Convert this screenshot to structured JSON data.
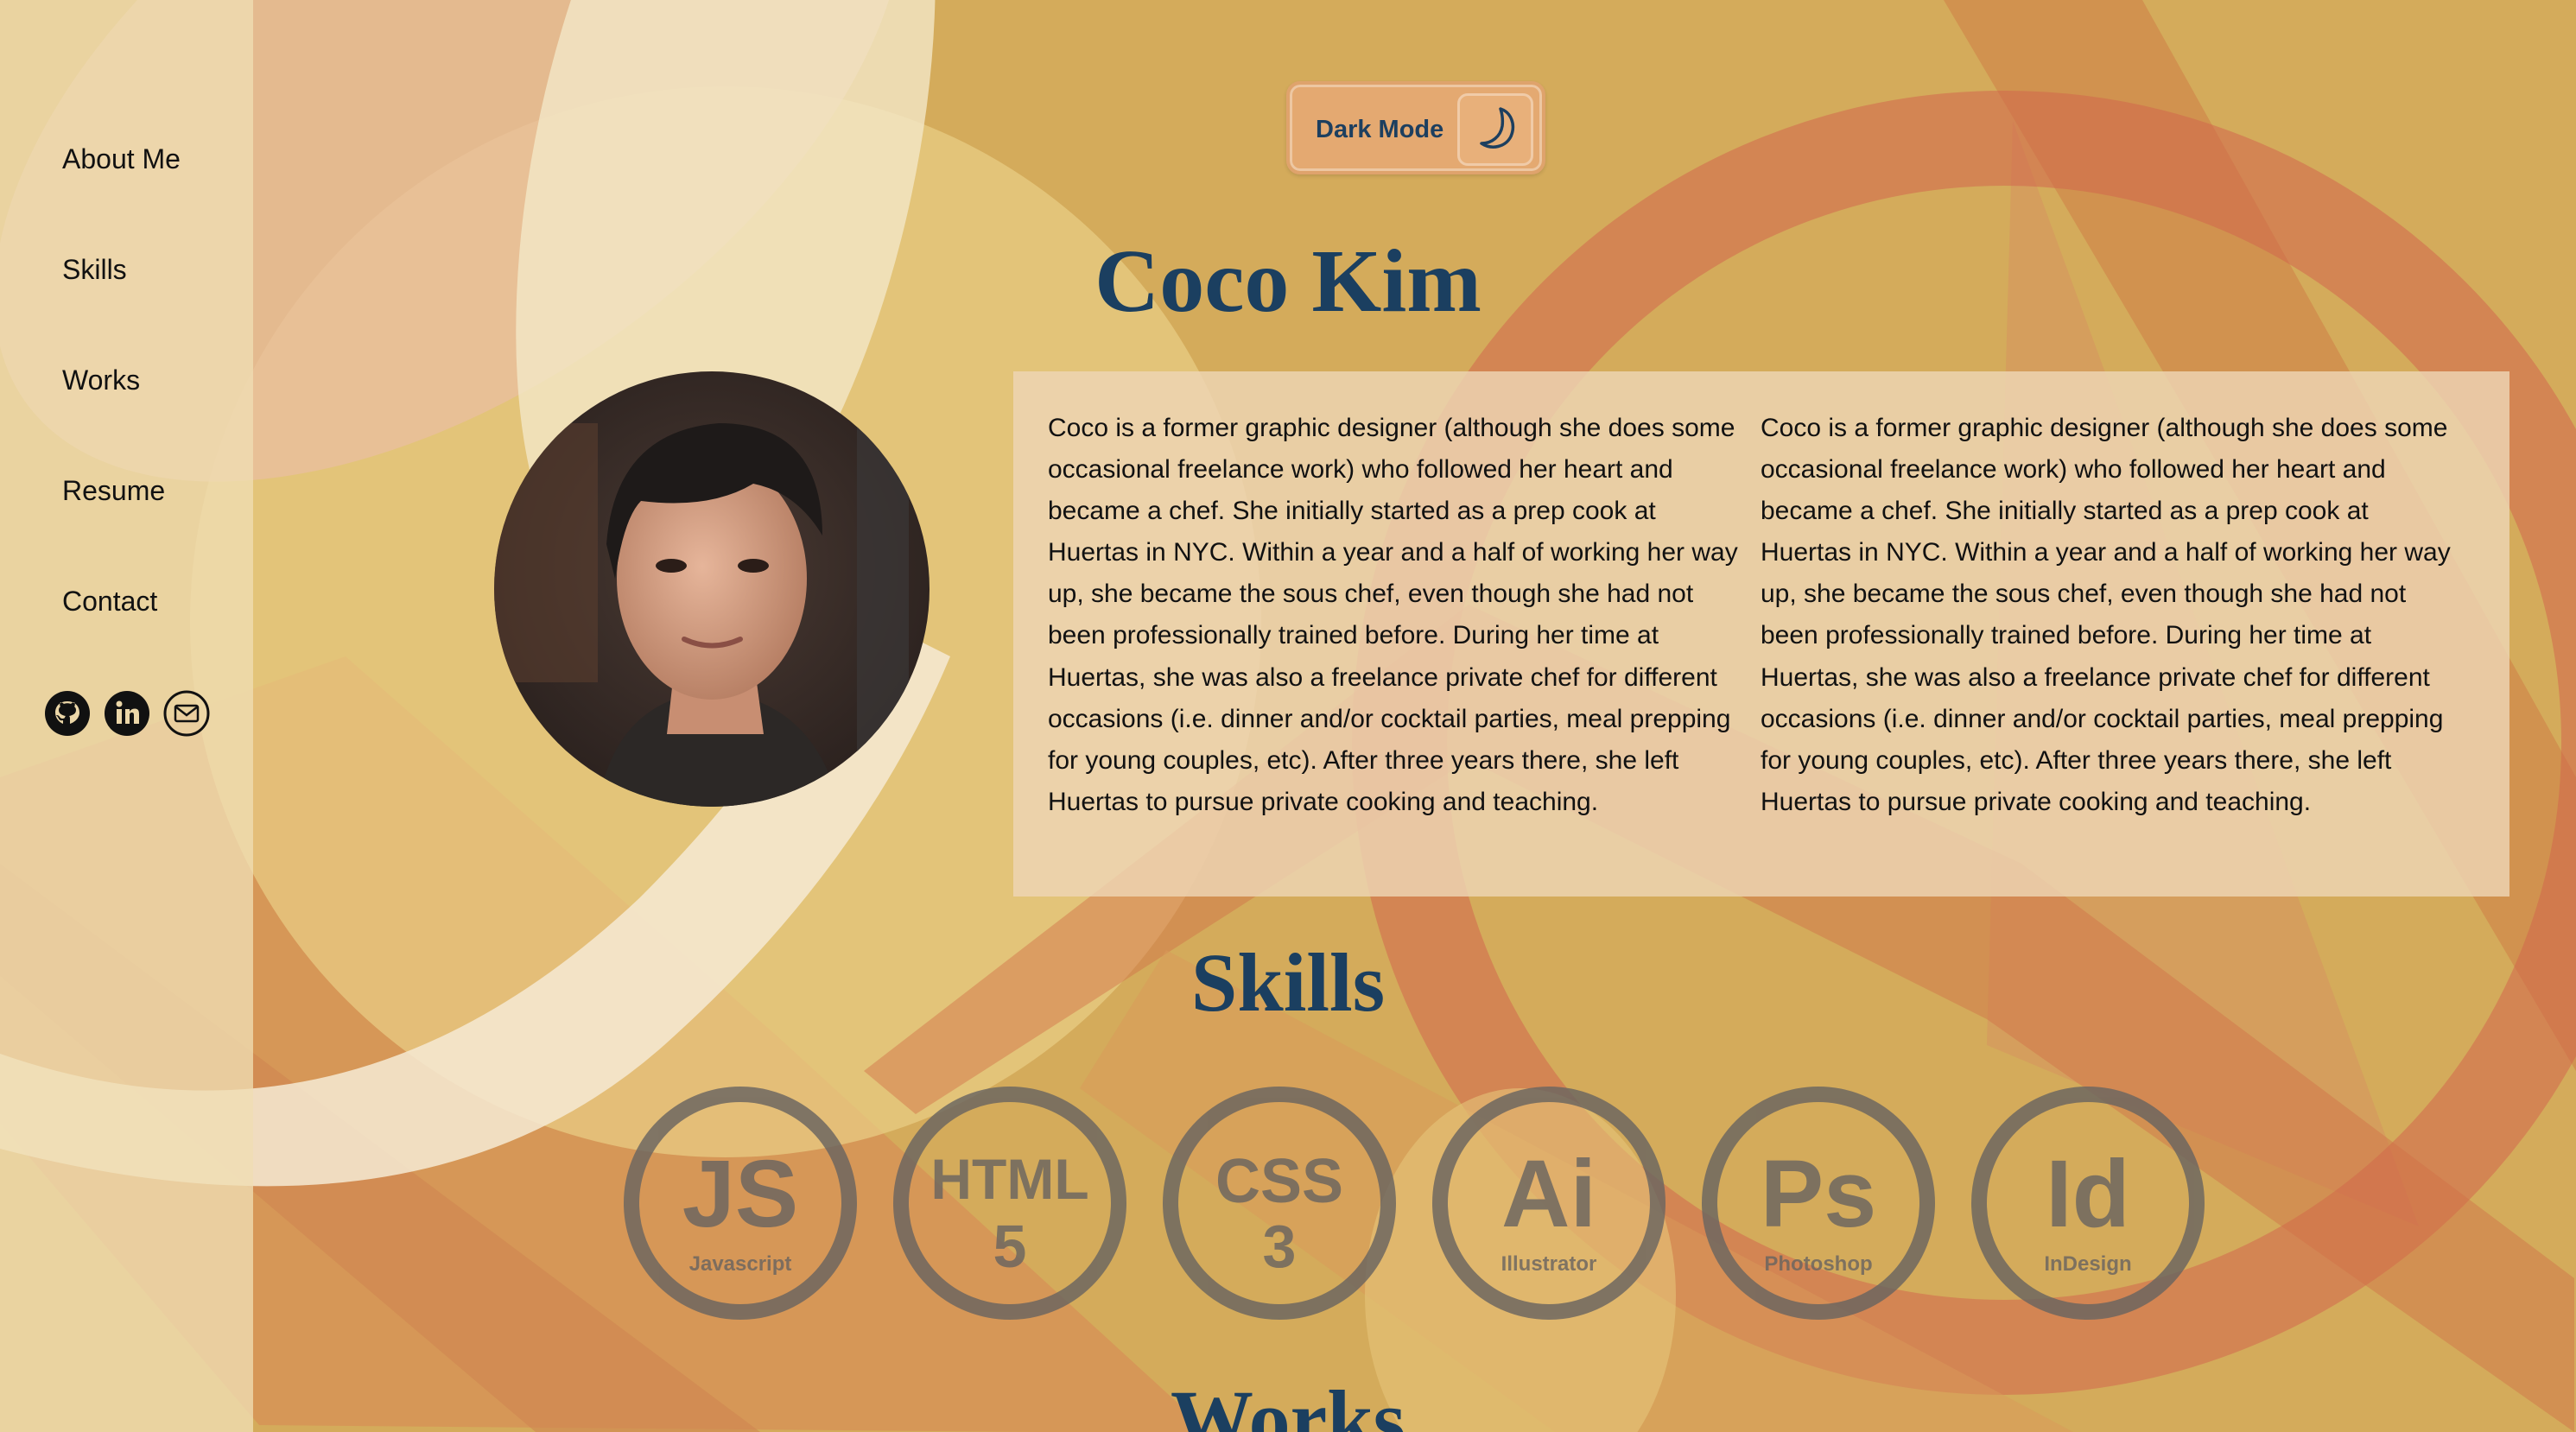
{
  "sidebar": {
    "items": [
      {
        "label": "About Me"
      },
      {
        "label": "Skills"
      },
      {
        "label": "Works"
      },
      {
        "label": "Resume"
      },
      {
        "label": "Contact"
      }
    ],
    "social_icons": [
      "github-icon",
      "linkedin-icon",
      "email-icon"
    ]
  },
  "toggle": {
    "label": "Dark Mode",
    "icon": "moon-icon"
  },
  "hero": {
    "name": "Coco Kim",
    "bio": "Coco is a former graphic designer (although she does some occasional freelance work) who followed her heart and became a chef. She initially started as a prep cook at Huertas in NYC. Within a year and a half of working her way up, she became the sous chef, even though she had not been professionally trained before. During her time at Huertas, she was also a freelance private chef for different occasions (i.e. dinner and/or cocktail parties, meal prepping for young couples, etc). After three years there, she left Huertas to pursue private cooking and teaching.",
    "bio_repeat": "Coco is a former graphic designer (although she does some occasional freelance work) who followed her heart and became a chef. She initially started as a prep cook at Huertas in NYC. Within a year and a half of working her way up, she became the sous chef, even though she had not been professionally trained before. During her time at Huertas, she was also a freelance private chef for different occasions (i.e. dinner and/or cocktail parties, meal prepping for young couples, etc). After three years there, she left Huertas to pursue private cooking and teaching."
  },
  "skills": {
    "title": "Skills",
    "items": [
      {
        "abbr": "JS",
        "sub": "",
        "name": "Javascript"
      },
      {
        "abbr": "HTML",
        "sub": "5",
        "name": ""
      },
      {
        "abbr": "CSS",
        "sub": "3",
        "name": ""
      },
      {
        "abbr": "Ai",
        "sub": "",
        "name": "Illustrator"
      },
      {
        "abbr": "Ps",
        "sub": "",
        "name": "Photoshop"
      },
      {
        "abbr": "Id",
        "sub": "",
        "name": "InDesign"
      }
    ]
  },
  "works": {
    "title": "Works"
  },
  "colors": {
    "background": "#d4ab5b",
    "sidebar": "#ecd7a8",
    "heading": "#1b3f60",
    "skill_icon": "#6a6560"
  }
}
